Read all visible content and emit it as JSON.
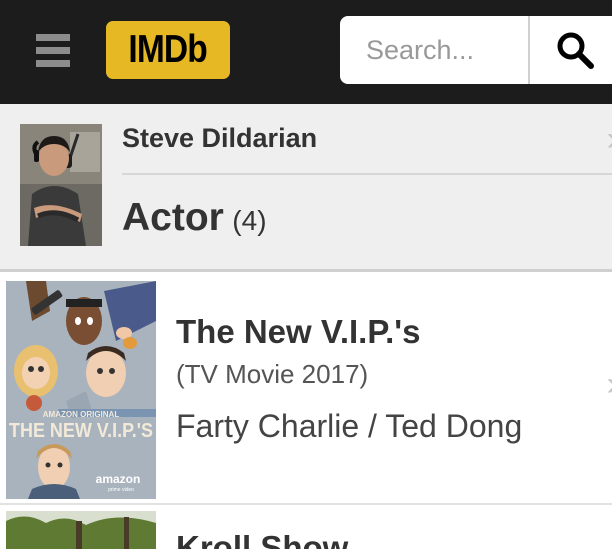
{
  "header": {
    "logo_text": "IMDb",
    "search_placeholder": "Search...",
    "menu_icon": "hamburger-menu-icon",
    "search_icon": "search-icon",
    "colors": {
      "bar": "#1c1c1c",
      "logo": "#e5b824"
    }
  },
  "person": {
    "name": "Steve Dildarian",
    "role": "Actor",
    "count": "(4)"
  },
  "credits": [
    {
      "title": "The New V.I.P.'s",
      "type": "(TV Movie 2017)",
      "role": "Farty Charlie / Ted Dong",
      "poster": {
        "tagline": "AMAZON ORIGINAL",
        "title": "THE NEW V.I.P.'S",
        "brand": "amazon",
        "sub": "prime video"
      }
    },
    {
      "title": "Kroll Show"
    }
  ]
}
